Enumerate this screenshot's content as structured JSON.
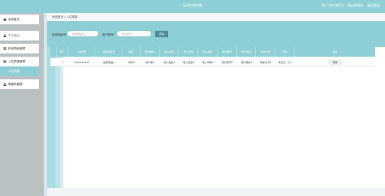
{
  "header": {
    "title": "无忧拍卖系统",
    "user_label": "用户 用户账号1",
    "logout_label": "退出到前台",
    "exit_label": "退出登录"
  },
  "sidebar": {
    "items": [
      {
        "label": "系统首页",
        "icon": "home-icon"
      },
      {
        "label": "个人中心",
        "icon": "user-icon"
      },
      {
        "label": "拍卖物品管理",
        "icon": "list-icon"
      },
      {
        "label": "入住预报管理",
        "icon": "grid-icon"
      },
      {
        "label": "入住预报",
        "active": true
      },
      {
        "label": "健康码管理",
        "icon": "user-icon"
      }
    ]
  },
  "breadcrumb": {
    "home": "系统首页",
    "sep": "/",
    "current": "入住预报"
  },
  "search": {
    "field1_label": "拍卖物品号",
    "field1_placeholder": "拍卖物品号",
    "field2_label": "用户账号",
    "field2_placeholder": "用户账号",
    "button": "查询"
  },
  "table": {
    "headers": [
      "",
      "索引",
      "入住编号",
      "拍卖物品号",
      "图片",
      "用户账号",
      "收入姓名",
      "收入性别",
      "收入年龄",
      "用户账号",
      "用户姓名",
      "联系方式",
      "状态",
      "操作"
    ],
    "rows": [
      [
        "",
        "1",
        "2222222222",
        "拍卖物品2",
        "商号2",
        "用户账2",
        "收入姓名2",
        "收入性别2",
        "收入年龄2",
        "用户账号2",
        "用户姓名2",
        "联系方式2",
        "未支付",
        "详情"
      ]
    ],
    "status_extra": "支付"
  },
  "colors": {
    "accent": "#8ecfd6",
    "button_dark": "#4e8f96",
    "sidebar_bg": "#b9c1c3"
  }
}
